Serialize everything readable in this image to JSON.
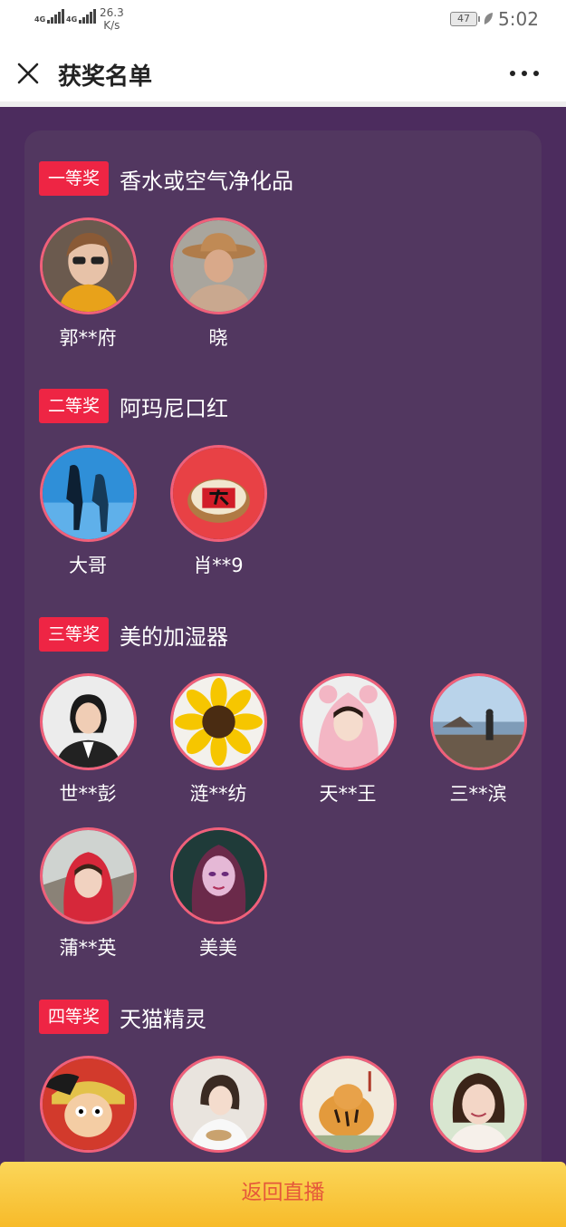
{
  "status_bar": {
    "sim1": "4G",
    "sim2": "4G",
    "speed_value": "26.3",
    "speed_unit": "K/s",
    "battery": "47",
    "time": "5:02"
  },
  "header": {
    "title": "获奖名单",
    "close_icon": "close-icon",
    "more_icon": "more-icon"
  },
  "prizes": [
    {
      "badge": "一等奖",
      "name": "香水或空气净化品",
      "winners": [
        {
          "name": "郭**府",
          "avatar": "woman-sunglasses"
        },
        {
          "name": "晓",
          "avatar": "man-straw-hat"
        }
      ]
    },
    {
      "badge": "二等奖",
      "name": "阿玛尼口红",
      "winners": [
        {
          "name": "大哥",
          "avatar": "blue-silhouettes"
        },
        {
          "name": "肖**9",
          "avatar": "red-bowl"
        }
      ]
    },
    {
      "badge": "三等奖",
      "name": "美的加湿器",
      "winners": [
        {
          "name": "世**彭",
          "avatar": "woman-suit"
        },
        {
          "name": "涟**纺",
          "avatar": "sunflower"
        },
        {
          "name": "天**王",
          "avatar": "pink-hood"
        },
        {
          "name": "三**滨",
          "avatar": "seaside"
        },
        {
          "name": "蒲**英",
          "avatar": "great-wall"
        },
        {
          "name": "美美",
          "avatar": "cartoon-woman"
        }
      ]
    },
    {
      "badge": "四等奖",
      "name": "天猫精灵",
      "winners": [
        {
          "name": "",
          "avatar": "cartoon-pirate"
        },
        {
          "name": "",
          "avatar": "girl-white"
        },
        {
          "name": "",
          "avatar": "tiger-painting"
        },
        {
          "name": "",
          "avatar": "smiling-woman"
        }
      ]
    }
  ],
  "bottom": {
    "return_label": "返回直播"
  },
  "colors": {
    "background": "#4c2c5e",
    "card": "#523760",
    "badge": "#ee2544",
    "avatar_border": "#f0607a",
    "button_text": "#e5583a",
    "button_bg": "#f9c63a"
  }
}
